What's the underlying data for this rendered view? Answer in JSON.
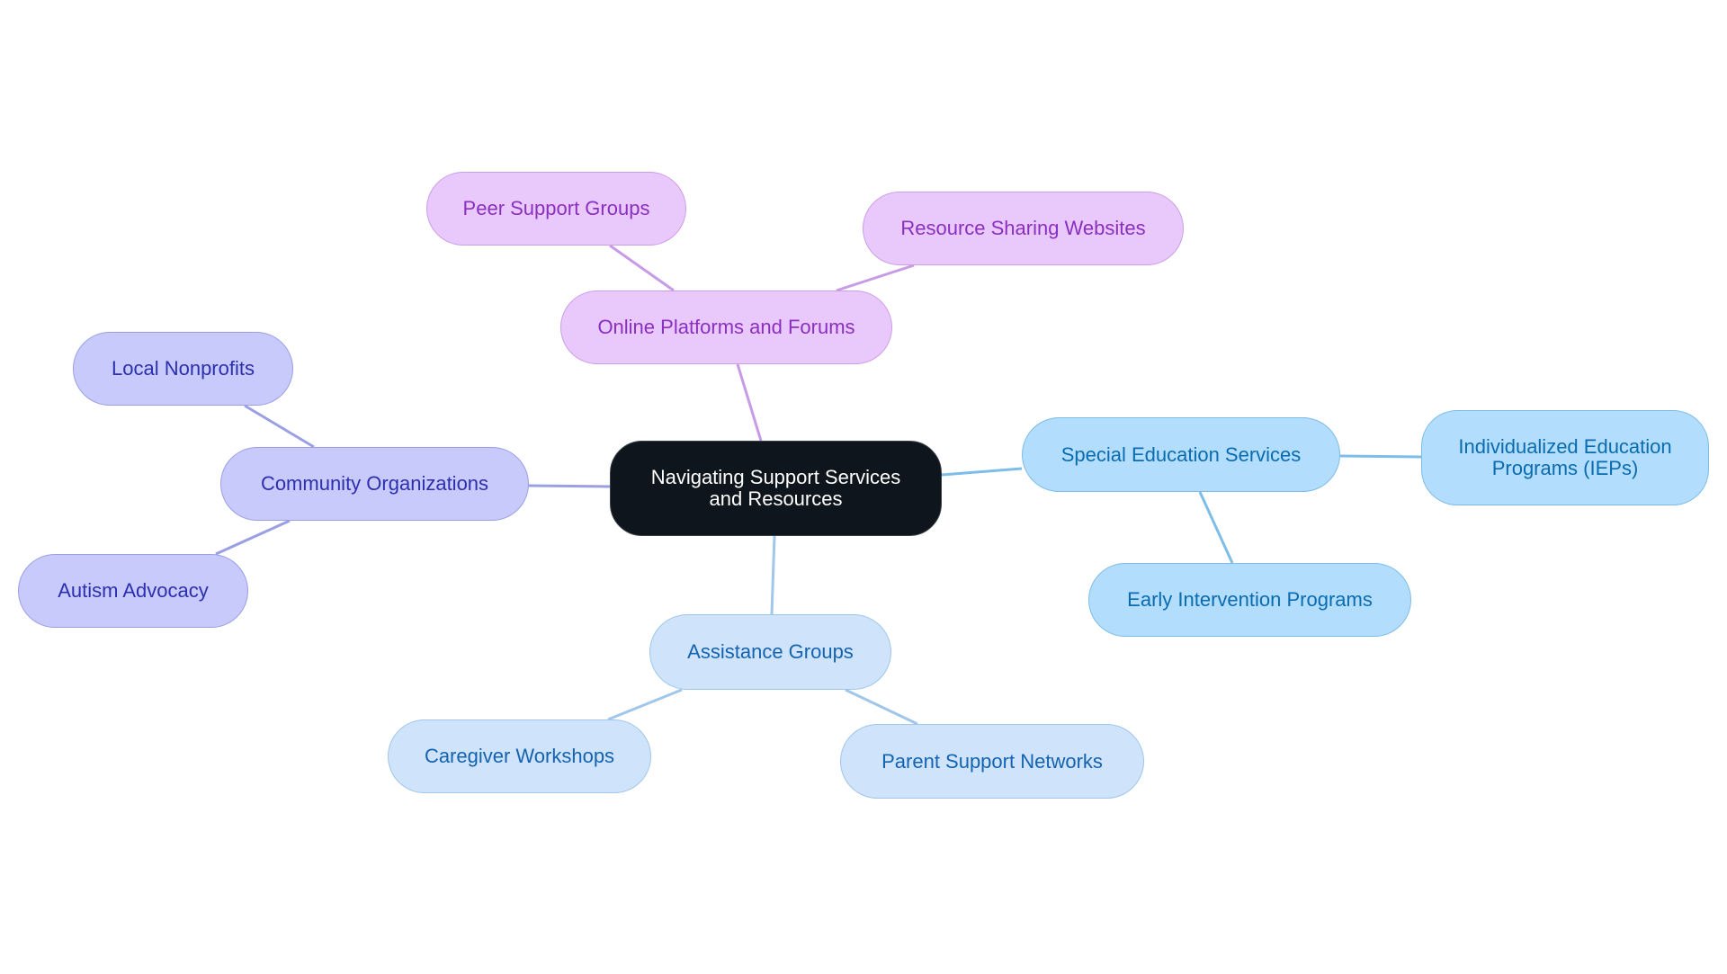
{
  "diagram": {
    "type": "mindmap",
    "root": {
      "id": "root",
      "label": "Navigating Support Services and Resources",
      "lines": [
        "Navigating Support Services",
        "and Resources"
      ]
    },
    "branches": [
      {
        "id": "online",
        "label": "Online Platforms and Forums",
        "color": "#c79be6",
        "children": [
          {
            "id": "peer",
            "label": "Peer Support Groups"
          },
          {
            "id": "resource",
            "label": "Resource Sharing Websites"
          }
        ]
      },
      {
        "id": "community",
        "label": "Community Organizations",
        "color": "#9a9fe4",
        "children": [
          {
            "id": "nonprofits",
            "label": "Local Nonprofits"
          },
          {
            "id": "autism",
            "label": "Autism Advocacy"
          }
        ]
      },
      {
        "id": "assistance",
        "label": "Assistance Groups",
        "color": "#a0c6ea",
        "children": [
          {
            "id": "caregiver",
            "label": "Caregiver Workshops"
          },
          {
            "id": "parent",
            "label": "Parent Support Networks"
          }
        ]
      },
      {
        "id": "special",
        "label": "Special Education Services",
        "color": "#7dbde8",
        "children": [
          {
            "id": "ieps",
            "label": "Individualized Education Programs (IEPs)",
            "lines": [
              "Individualized Education",
              "Programs (IEPs)"
            ]
          },
          {
            "id": "early",
            "label": "Early Intervention Programs"
          }
        ]
      }
    ]
  },
  "colors": {
    "root_bg": "#0f151c",
    "online_bg": "#e9c9fc",
    "online_text": "#8a2fc0",
    "community_bg": "#c8cafc",
    "community_text": "#2c2fae",
    "special_bg": "#b3ddfc",
    "special_text": "#0a6cb0",
    "assistance_bg": "#cfe3fb",
    "assistance_text": "#1463b0"
  }
}
